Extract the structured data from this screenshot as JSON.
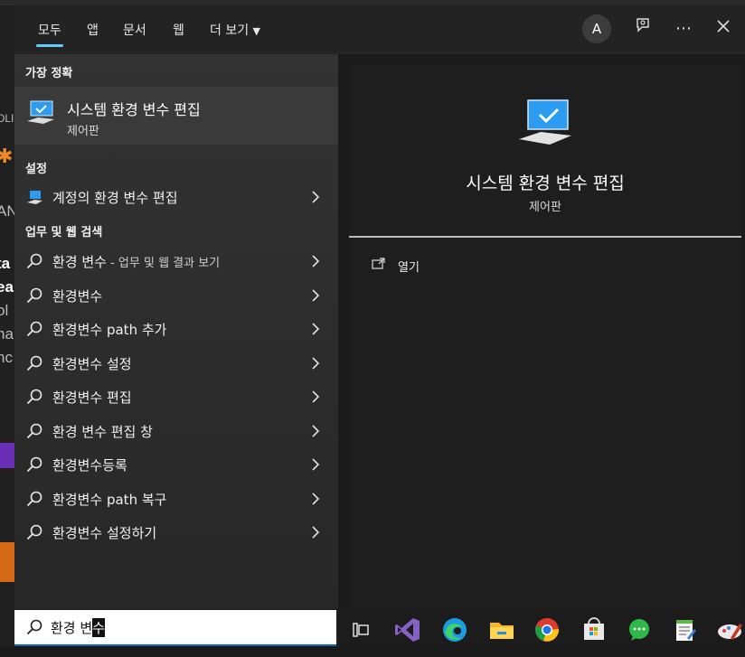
{
  "tabs": [
    "모두",
    "앱",
    "문서",
    "웹",
    "더 보기"
  ],
  "header": {
    "avatar": "A"
  },
  "sections": {
    "best": "가장 정확",
    "settings": "설정",
    "web": "업무 및 웹 검색"
  },
  "best_match": {
    "title": "시스템 환경 변수 편집",
    "subtitle": "제어판"
  },
  "settings_items": [
    {
      "label": "계정의 환경 변수 편집"
    }
  ],
  "web_items": [
    {
      "label": "환경 변수",
      "sub": " - 업무 및 웹 결과 보기"
    },
    {
      "label": "환경변수",
      "sub": ""
    },
    {
      "label": "환경변수 path 추가",
      "sub": ""
    },
    {
      "label": "환경변수 설정",
      "sub": ""
    },
    {
      "label": "환경변수 편집",
      "sub": ""
    },
    {
      "label": "환경 변수 편집 창",
      "sub": ""
    },
    {
      "label": "환경변수등록",
      "sub": ""
    },
    {
      "label": "환경변수 path 복구",
      "sub": ""
    },
    {
      "label": "환경변수 설정하기",
      "sub": ""
    }
  ],
  "preview": {
    "title": "시스템 환경 변수 편집",
    "subtitle": "제어판",
    "action_open": "열기"
  },
  "search": {
    "typed": "환경 변",
    "cursor_char": "수"
  },
  "background_fragments": [
    "OLI",
    "AN",
    "ta",
    "ea",
    "ol",
    "ha",
    "nc"
  ],
  "taskbar_icons": [
    "task-view-icon",
    "visual-studio-icon",
    "edge-icon",
    "file-explorer-icon",
    "chrome-icon",
    "store-icon",
    "chat-icon",
    "notepad-icon",
    "paint-icon"
  ]
}
